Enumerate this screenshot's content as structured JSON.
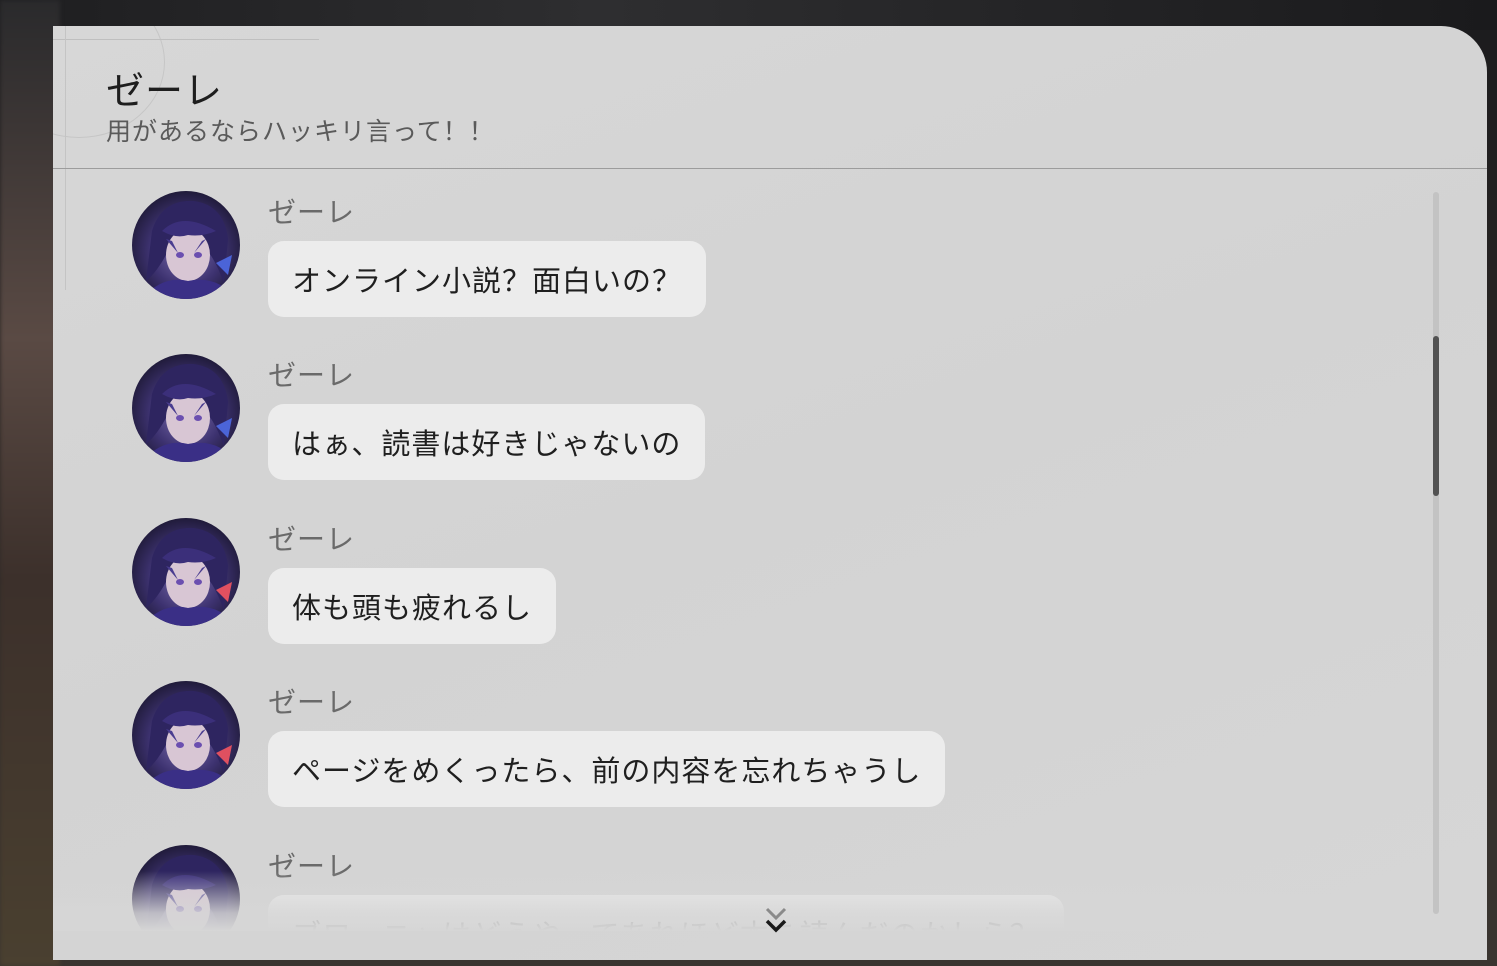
{
  "header": {
    "title": "ゼーレ",
    "subtitle": "用があるならハッキリ言って！！"
  },
  "messages": [
    {
      "sender": "ゼーレ",
      "text": "オンライン小説？面白いの？"
    },
    {
      "sender": "ゼーレ",
      "text": "はぁ、読書は好きじゃないの"
    },
    {
      "sender": "ゼーレ",
      "text": "体も頭も疲れるし"
    },
    {
      "sender": "ゼーレ",
      "text": "ページをめくったら、前の内容を忘れちゃうし"
    },
    {
      "sender": "ゼーレ",
      "text": "ブローニャはどうやってあれほど本を読んだのかしら？"
    }
  ],
  "icons": {
    "avatar": "seele-avatar",
    "more": "double-chevron-down-icon"
  },
  "colors": {
    "panel": "#d6d6d6",
    "bubble": "#ececec",
    "scroll_thumb": "#525252"
  }
}
